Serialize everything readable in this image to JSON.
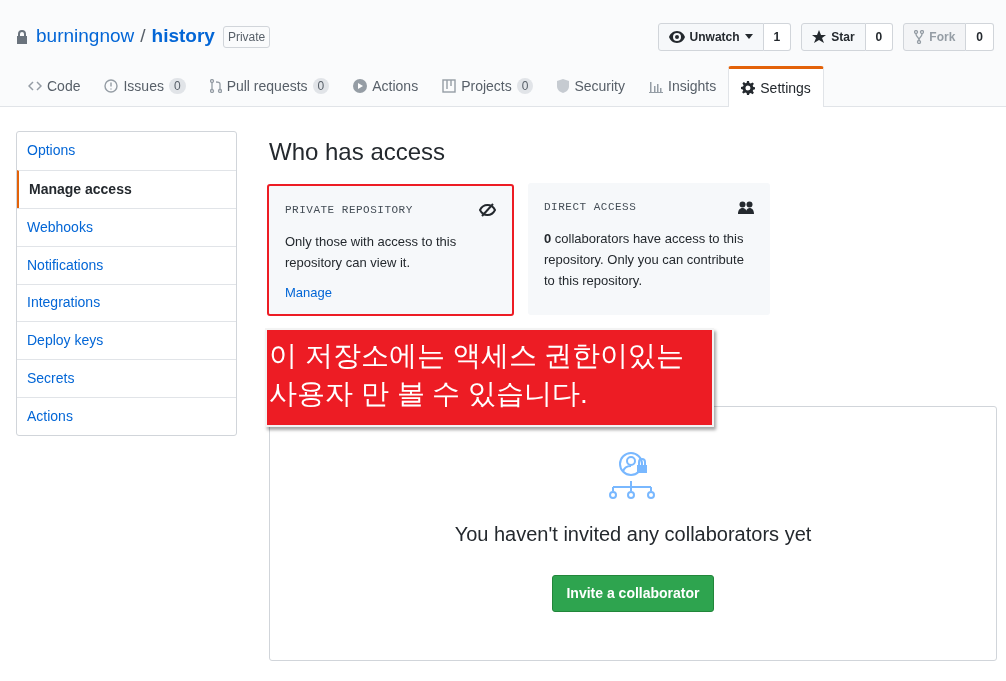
{
  "repo": {
    "owner": "burningnow",
    "separator": "/",
    "name": "history",
    "visibility": "Private"
  },
  "actions": [
    {
      "kind": "watch",
      "label": "Unwatch",
      "count": "1",
      "disabled": false
    },
    {
      "kind": "star",
      "label": "Star",
      "count": "0",
      "disabled": false
    },
    {
      "kind": "fork",
      "label": "Fork",
      "count": "0",
      "disabled": true
    }
  ],
  "tabs": [
    {
      "kind": "code",
      "label": "Code",
      "selected": false
    },
    {
      "kind": "issues",
      "label": "Issues",
      "counter": "0",
      "selected": false
    },
    {
      "kind": "pulls",
      "label": "Pull requests",
      "counter": "0",
      "selected": false
    },
    {
      "kind": "actions",
      "label": "Actions",
      "selected": false
    },
    {
      "kind": "projects",
      "label": "Projects",
      "counter": "0",
      "selected": false
    },
    {
      "kind": "security",
      "label": "Security",
      "selected": false
    },
    {
      "kind": "insights",
      "label": "Insights",
      "selected": false
    },
    {
      "kind": "settings",
      "label": "Settings",
      "selected": true
    }
  ],
  "sidebar": {
    "items": [
      {
        "label": "Options",
        "selected": false
      },
      {
        "label": "Manage access",
        "selected": true
      },
      {
        "label": "Webhooks",
        "selected": false
      },
      {
        "label": "Notifications",
        "selected": false
      },
      {
        "label": "Integrations",
        "selected": false
      },
      {
        "label": "Deploy keys",
        "selected": false
      },
      {
        "label": "Secrets",
        "selected": false
      },
      {
        "label": "Actions",
        "selected": false
      }
    ]
  },
  "heading": "Who has access",
  "cards": [
    {
      "kind": "private",
      "title": "PRIVATE REPOSITORY",
      "text": "Only those with access to this repository can view it.",
      "link": "Manage",
      "highlighted": true
    },
    {
      "kind": "direct",
      "title": "DIRECT ACCESS",
      "text": "**0** collaborators have access to this repository. Only you can contribute to this repository.",
      "highlighted": false
    }
  ],
  "callout": "이 저장소에는 액세스 권한이있는 사용자 만 볼 수 있습니다.",
  "empty_state": {
    "message": "You haven't invited any collaborators yet",
    "button": "Invite a collaborator"
  }
}
